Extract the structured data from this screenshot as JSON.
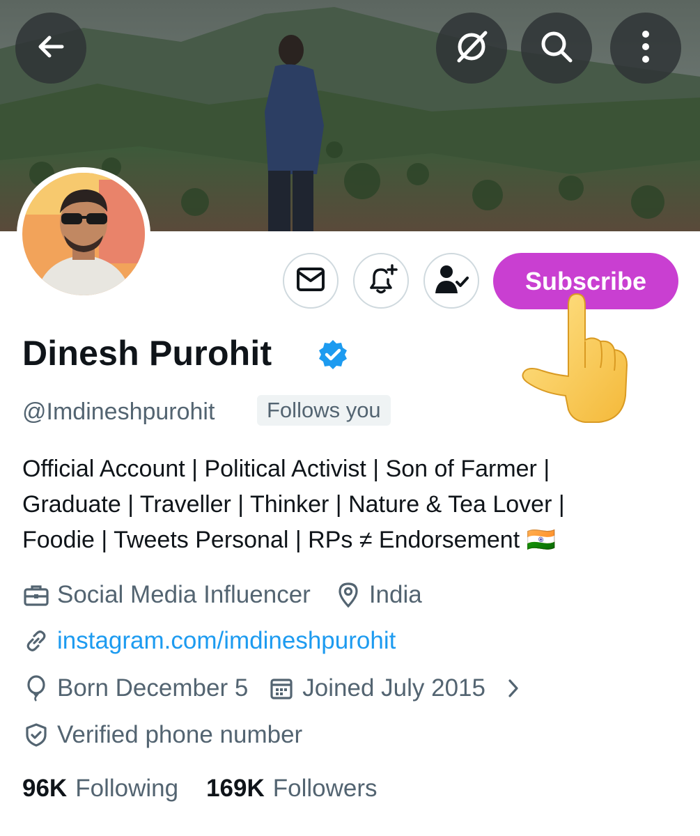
{
  "topbar": {
    "back_icon": "arrow-left-icon",
    "icons": [
      "grok-icon",
      "search-icon",
      "more-vertical-icon"
    ]
  },
  "actions": {
    "message_icon": "envelope-icon",
    "notify_icon": "bell-plus-icon",
    "following_icon": "person-check-icon",
    "subscribe_label": "Subscribe",
    "subscribe_color": "#c93fd1"
  },
  "profile": {
    "name": "Dinesh Purohit",
    "handle": "@Imdineshpurohit",
    "follows_you": "Follows you",
    "bio_lines": [
      "Official Account | Political Activist | Son of Farmer |",
      "Graduate | Traveller | Thinker | Nature & Tea Lover |",
      "Foodie | Tweets Personal | RPs ≠ Endorsement 🇮🇳"
    ],
    "category": "Social Media Influencer",
    "location": "India",
    "link": "instagram.com/imdineshpurohit",
    "born": "Born December 5",
    "joined": "Joined July 2015",
    "verified_phone": "Verified phone number"
  },
  "stats": {
    "following_count": "96K",
    "following_label": "Following",
    "followers_count": "169K",
    "followers_label": "Followers"
  },
  "colors": {
    "verified": "#1d9bf0",
    "link": "#1d9bf0",
    "secondary_text": "#536471"
  }
}
